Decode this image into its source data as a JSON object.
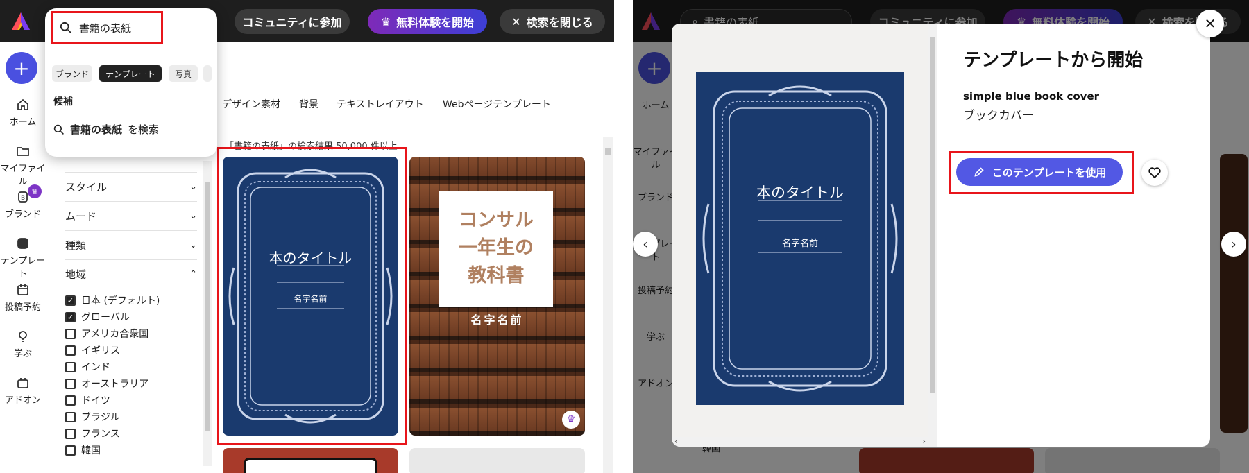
{
  "left": {
    "topbar": {
      "community": "コミュニティに参加",
      "trial": "無料体験を開始",
      "close_search": "検索を閉じる"
    },
    "rail": {
      "items": [
        {
          "label": "ホーム"
        },
        {
          "label": "マイファイル"
        },
        {
          "label": "ブランド"
        },
        {
          "label": "テンプレート"
        },
        {
          "label": "投稿予約"
        },
        {
          "label": "学ぶ"
        },
        {
          "label": "アドオン"
        }
      ]
    },
    "search": {
      "value": "書籍の表紙",
      "chips": [
        "ブランド",
        "テンプレート",
        "写真"
      ],
      "suggest_heading": "候補",
      "suggest_query": "書籍の表紙",
      "suggest_suffix": "を検索"
    },
    "categories": [
      "デザイン素材",
      "背景",
      "テキストレイアウト",
      "Webページテンプレート"
    ],
    "results_text": "「書籍の表紙」の検索結果 50,000 件以上",
    "filters": {
      "rows": [
        "スタイル",
        "ムード",
        "種類",
        "地域"
      ],
      "regions": [
        {
          "label": "日本 (デフォルト)",
          "checked": true
        },
        {
          "label": "グローバル",
          "checked": true
        },
        {
          "label": "アメリカ合衆国",
          "checked": false
        },
        {
          "label": "イギリス",
          "checked": false
        },
        {
          "label": "インド",
          "checked": false
        },
        {
          "label": "オーストラリア",
          "checked": false
        },
        {
          "label": "ドイツ",
          "checked": false
        },
        {
          "label": "ブラジル",
          "checked": false
        },
        {
          "label": "フランス",
          "checked": false
        },
        {
          "label": "韓国",
          "checked": false
        }
      ]
    },
    "cards": {
      "blue": {
        "title": "本のタイトル",
        "author": "名字名前"
      },
      "books": {
        "line1": "コンサル",
        "line2": "一年生の",
        "line3": "教科書",
        "author": "名字名前"
      }
    }
  },
  "right": {
    "modal": {
      "title": "テンプレートから開始",
      "template_name": "simple blue book cover",
      "template_type": "ブックカバー",
      "use_button": "このテンプレートを使用",
      "cover_title": "本のタイトル",
      "cover_author": "名字名前"
    },
    "bg": {
      "search": "書籍の表紙",
      "community": "コミュニティに参加",
      "trial": "無料体験を開始",
      "close_search": "検索を閉じる",
      "rail": [
        "ホーム",
        "マイファイル",
        "ブランド",
        "テンプレート",
        "投稿予約",
        "学ぶ",
        "アドオン"
      ],
      "region_partial": "韓国"
    }
  },
  "colors": {
    "accent": "#5258e4",
    "highlight": "#e8151b",
    "cover_blue": "#1a3a6e",
    "topbar": "#1e1e1e"
  }
}
